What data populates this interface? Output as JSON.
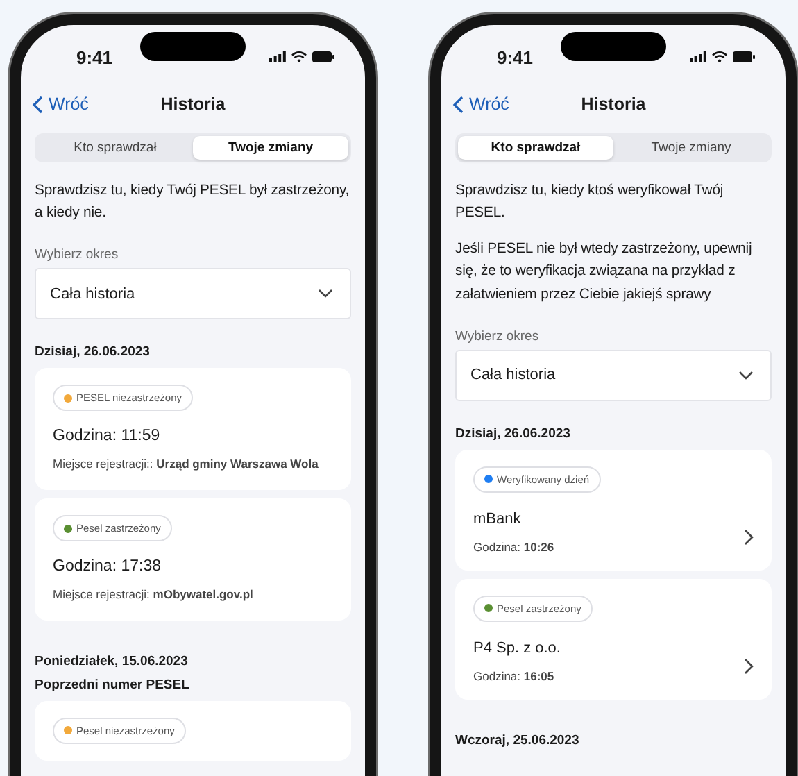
{
  "phones": [
    {
      "status_bar": {
        "time": "9:41"
      },
      "nav": {
        "back": "Wróć",
        "title": "Historia"
      },
      "tabs": [
        {
          "label": "Kto sprawdzał",
          "selected": false
        },
        {
          "label": "Twoje zmiany",
          "selected": true
        }
      ],
      "intro": [
        "Sprawdzisz tu, kiedy Twój PESEL był zastrzeżony, a kiedy nie."
      ],
      "period": {
        "label": "Wybierz okres",
        "value": "Cała historia"
      },
      "sections": [
        {
          "heading": "Dzisiaj, 26.06.2023",
          "cards": [
            {
              "kind": "change",
              "status": {
                "label": "PESEL niezastrzeżony",
                "color": "#f2a93b"
              },
              "time": "Godzina: 11:59",
              "place": "Miejsce rejestracji:: **Urząd gminy Warszawa Wola**"
            },
            {
              "kind": "change",
              "status": {
                "label": "Pesel zastrzeżony",
                "color": "#5a8f32"
              },
              "time": "Godzina: 17:38",
              "place": "Miejsce rejestracji: **mObywatel.gov.pl**"
            }
          ]
        },
        {
          "heading": "Poniedziałek, 15.06.2023",
          "subheading": "Poprzedni numer PESEL",
          "cards": [
            {
              "kind": "change",
              "status": {
                "label": "Pesel niezastrzeżony",
                "color": "#f2a93b"
              }
            }
          ]
        }
      ]
    },
    {
      "status_bar": {
        "time": "9:41"
      },
      "nav": {
        "back": "Wróć",
        "title": "Historia"
      },
      "tabs": [
        {
          "label": "Kto sprawdzał",
          "selected": true
        },
        {
          "label": "Twoje zmiany",
          "selected": false
        }
      ],
      "intro": [
        "Sprawdzisz tu, kiedy ktoś weryfikował Twój PESEL.",
        "Jeśli PESEL nie był wtedy zastrzeżony, upewnij się, że to weryfikacja związana na przykład z załatwieniem przez Ciebie jakiejś sprawy"
      ],
      "period": {
        "label": "Wybierz okres",
        "value": "Cała historia"
      },
      "sections": [
        {
          "heading": "Dzisiaj, 26.06.2023",
          "cards": [
            {
              "kind": "verification",
              "status": {
                "label": "Weryfikowany dzień",
                "color": "#1f7ef2"
              },
              "title": "mBank",
              "time": "Godzina: **10:26**"
            },
            {
              "kind": "verification",
              "status": {
                "label": "Pesel zastrzeżony",
                "color": "#5a8f32"
              },
              "title": "P4 Sp. z o.o.",
              "time": "Godzina: **16:05**"
            }
          ]
        },
        {
          "heading": "Wczoraj, 25.06.2023"
        }
      ]
    }
  ]
}
